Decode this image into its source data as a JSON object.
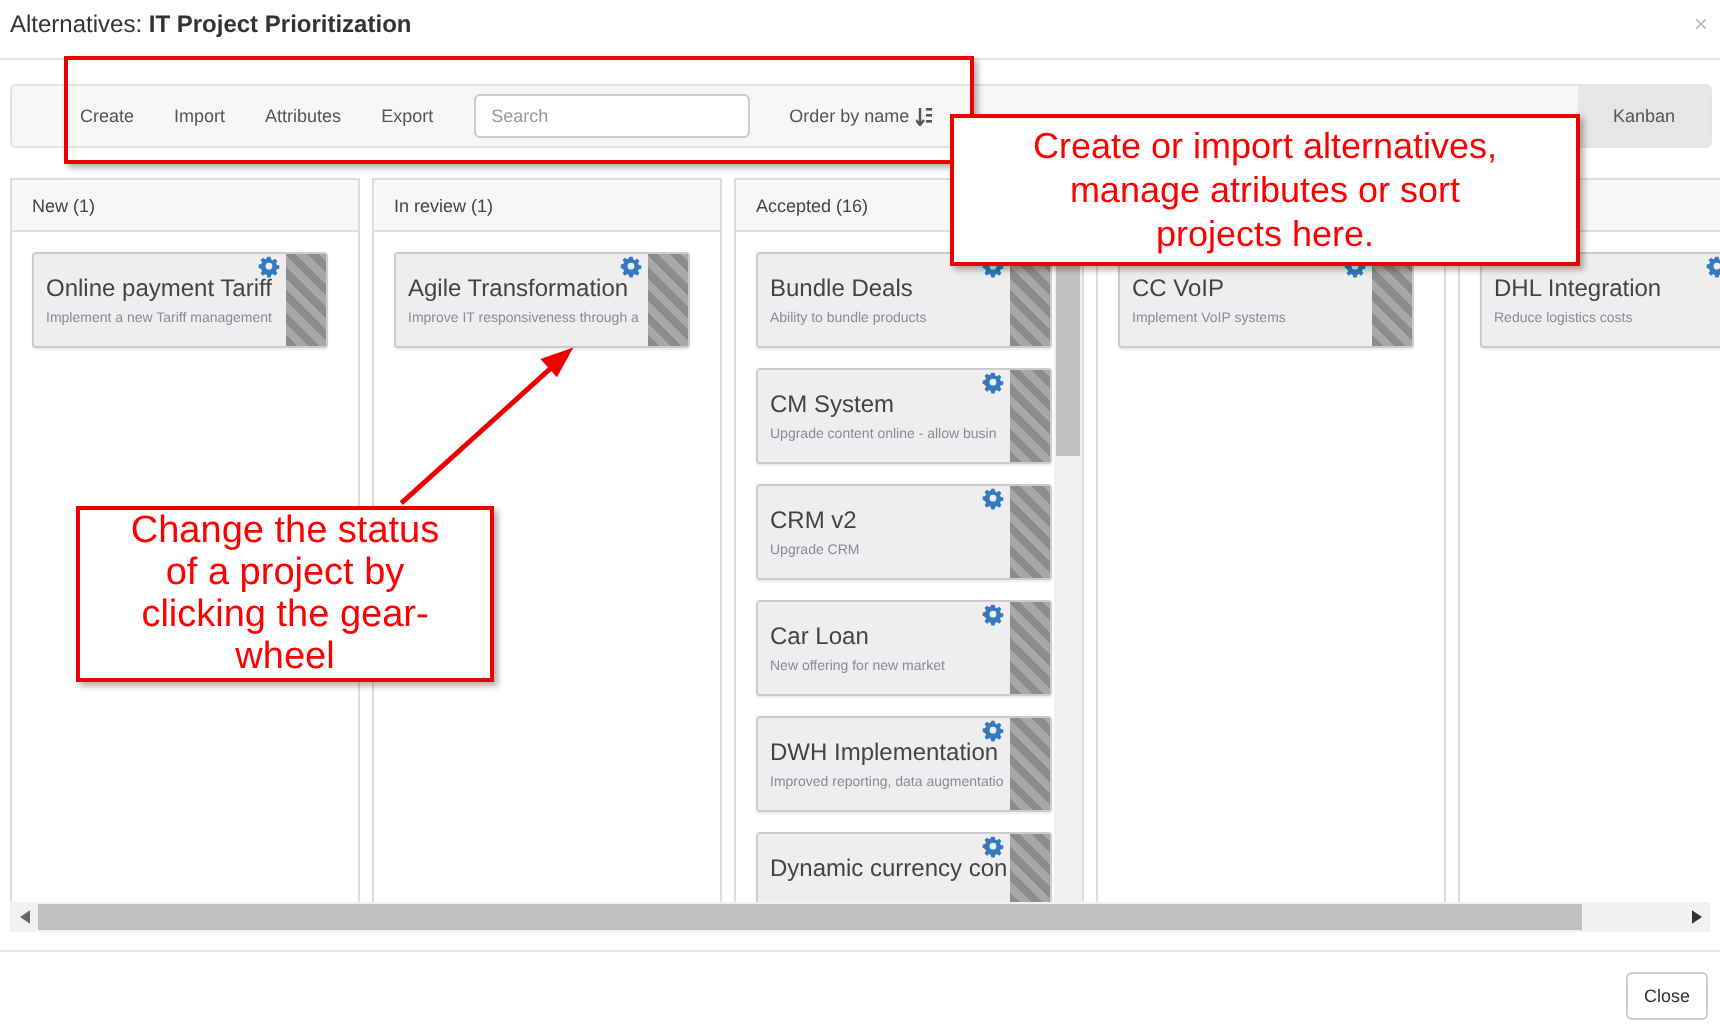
{
  "dialog": {
    "title": "Alternatives: **IT Project Prioritization**",
    "close": "×"
  },
  "toolbar": {
    "actions": [
      "Create",
      "Import",
      "Attributes",
      "Export"
    ],
    "search": {
      "placeholder": "Search"
    },
    "order": "Order by name",
    "views": [
      {
        "label": "Kanban",
        "selected": true
      }
    ]
  },
  "columns": [
    {
      "title": "New (1)",
      "scrollbar": false,
      "cards": [
        {
          "title": "Online payment Tariff",
          "description": "Implement a new Tariff management"
        }
      ]
    },
    {
      "title": "In review (1)",
      "scrollbar": false,
      "cards": [
        {
          "title": "Agile Transformation",
          "description": "Improve IT responsiveness through a"
        }
      ]
    },
    {
      "title": "Accepted (16)",
      "scrollbar": true,
      "cards": [
        {
          "title": "Bundle Deals",
          "description": "Ability to bundle products"
        },
        {
          "title": "CM System",
          "description": "Upgrade content online - allow busin"
        },
        {
          "title": "CRM v2",
          "description": "Upgrade CRM"
        },
        {
          "title": "Car Loan",
          "description": "New offering for new market"
        },
        {
          "title": "DWH Implementation",
          "description": "Improved reporting, data augmentatio"
        },
        {
          "title": "Dynamic currency con"
        }
      ]
    },
    {
      "scrollbar": false,
      "cards": [
        {
          "title": "CC VoIP",
          "description": "Implement VoIP systems"
        }
      ]
    },
    {
      "cards": [
        {
          "title": "DHL Integration",
          "description": "Reduce logistics costs"
        }
      ]
    }
  ],
  "footer": {
    "buttons": [
      "Close"
    ]
  },
  "annotations": [
    {
      "kind": "frame"
    },
    {
      "kind": "callout",
      "text": "Create or import alternatives, manage atributes or sort projects here."
    },
    {
      "kind": "callout",
      "text": "Change the status of a project by clicking the gear-wheel"
    },
    {
      "kind": "arrow"
    }
  ]
}
